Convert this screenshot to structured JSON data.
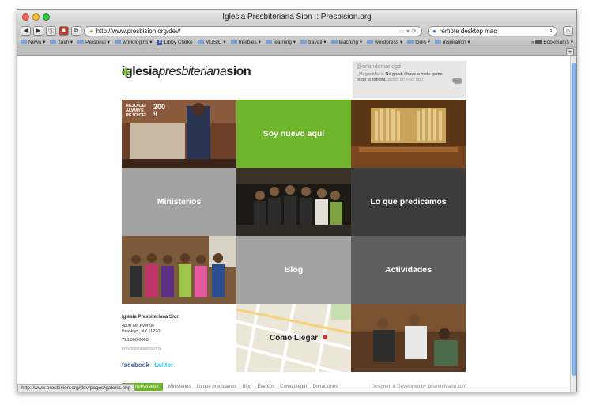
{
  "window": {
    "title": "Iglesia Presbiteriana Sion :: Presbision.org",
    "url": "http://www.presbision.org/dev/",
    "search_query": "remote desktop mac",
    "status_url": "http://www.presbision.org/dev/pages/galeria.php"
  },
  "bookmarks": [
    {
      "label": "News",
      "icon": "folder-icon"
    },
    {
      "label": "flash",
      "icon": "folder-icon"
    },
    {
      "label": "Personal",
      "icon": "folder-icon"
    },
    {
      "label": "work logins",
      "icon": "folder-icon"
    },
    {
      "label": "Libby Clarke",
      "icon": "facebook-icon"
    },
    {
      "label": "MUSIC",
      "icon": "folder-icon"
    },
    {
      "label": "freebies",
      "icon": "folder-icon"
    },
    {
      "label": "learning",
      "icon": "folder-icon"
    },
    {
      "label": "travail",
      "icon": "folder-icon"
    },
    {
      "label": "teaching",
      "icon": "folder-icon"
    },
    {
      "label": "wordpress",
      "icon": "folder-icon"
    },
    {
      "label": "tools",
      "icon": "folder-icon"
    },
    {
      "label": "inspiration",
      "icon": "folder-icon"
    },
    {
      "label": "Bookmarks",
      "icon": "bookmarks-icon"
    }
  ],
  "site": {
    "logo": {
      "bold": "iglesia",
      "italic": "presbiteriana",
      "last": "sion"
    },
    "tweet": {
      "handle": "@orlandomariogd",
      "body_user": "_MeganMaine",
      "body": "No good, I have a mets game to go to tonight.",
      "ago": "about an hour ago"
    },
    "tiles": {
      "soy_nuevo": "Soy nuevo aquí",
      "ministerios": "Ministerios",
      "lo_que_predicamos": "Lo que predicamos",
      "blog": "Blog",
      "actividades": "Actividades",
      "como_llegar": "Como Llegar",
      "rejoice": "REJOICE! ALWAYS REJOICE!",
      "year": "2009"
    },
    "info": {
      "name": "Iglesia Presbiteriana Sion",
      "address1": "4800 6th Avenue",
      "address2": "Brooklyn, NY 11220",
      "phone": "718.000.0000",
      "email": "info@presbision.org",
      "facebook": "facebook",
      "twitter": "twitter"
    },
    "footer": {
      "nav": [
        "Soy nuevo aquí",
        "Ministerios",
        "Lo que predicamos",
        "Blog",
        "Eventos",
        "Como Llegar",
        "Donaciones"
      ],
      "credit": "Designed & Developed by OrlandoMario.com"
    }
  },
  "colors": {
    "green": "#6fb52c",
    "mid_gray": "#a3a3a3",
    "dark_gray": "#5e5e5e",
    "darker_gray": "#3c3c3c",
    "facebook": "#3b5998",
    "twitter": "#33ccff"
  }
}
